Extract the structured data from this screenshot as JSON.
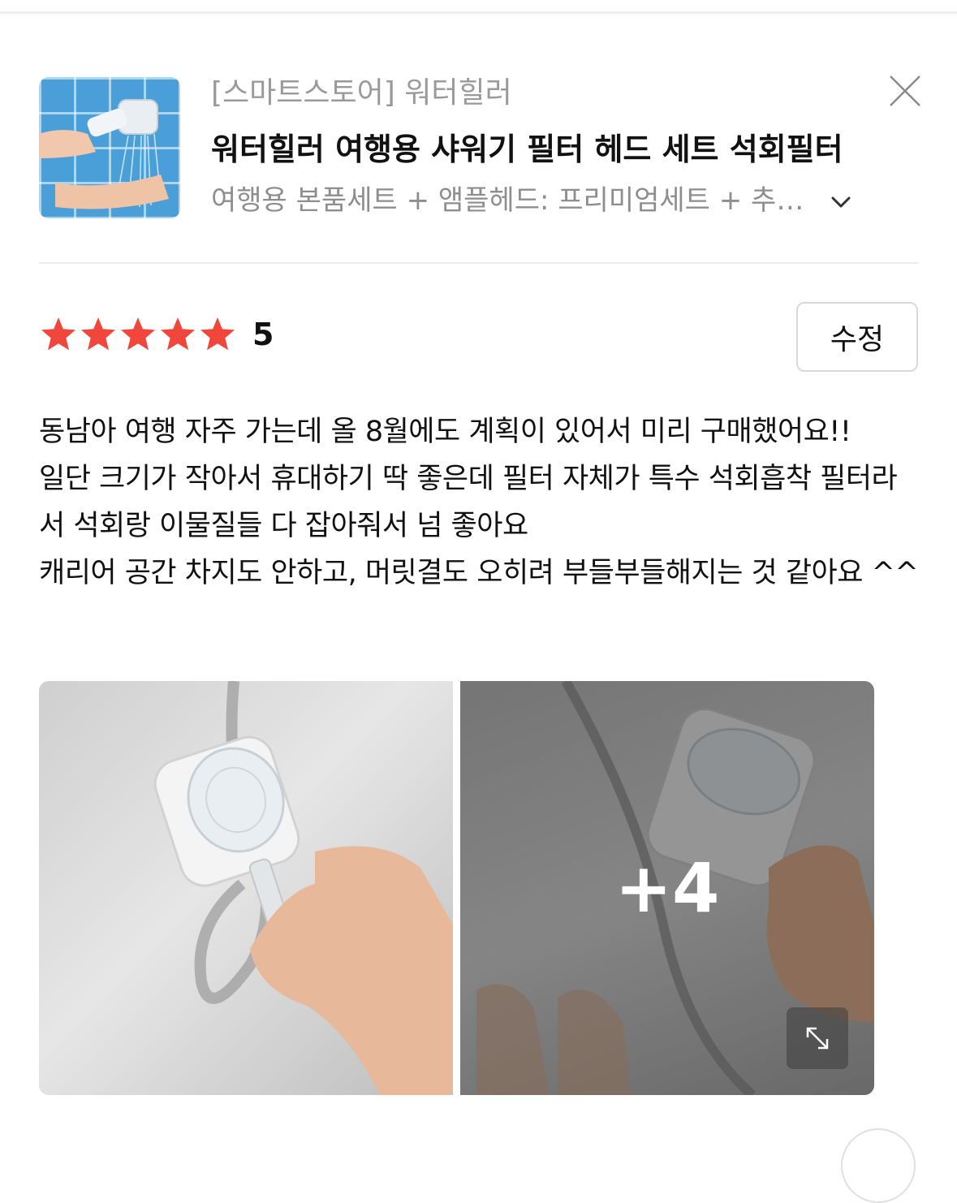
{
  "product": {
    "store": "[스마트스토어] 워터힐러",
    "title": "워터힐러 여행용 샤워기 필터 헤드 세트 석회필터",
    "option": "여행용 본품세트 + 앰플헤드: 프리미엄세트 + 추가필터"
  },
  "rating": {
    "stars": 5,
    "score": "5",
    "star_color": "#f0463c"
  },
  "actions": {
    "edit_label": "수정"
  },
  "review": {
    "text": "동남아 여행 자주 가는데 올 8월에도 계획이 있어서 미리 구매했어요!!\n일단 크기가 작아서 휴대하기 딱 좋은데 필터 자체가 특수 석회흡착 필터라서 석회랑 이물질들 다 잡아줘서 넘 좋아요\n캐리어 공간 차지도 안하고, 머릿결도 오히려 부들부들해지는 것 같아요 ^^"
  },
  "photos": {
    "more_count": "+4"
  },
  "icons": {
    "close": "close-icon",
    "option_toggle": "chevron-down-icon",
    "expand": "expand-icon",
    "star": "star-icon"
  }
}
